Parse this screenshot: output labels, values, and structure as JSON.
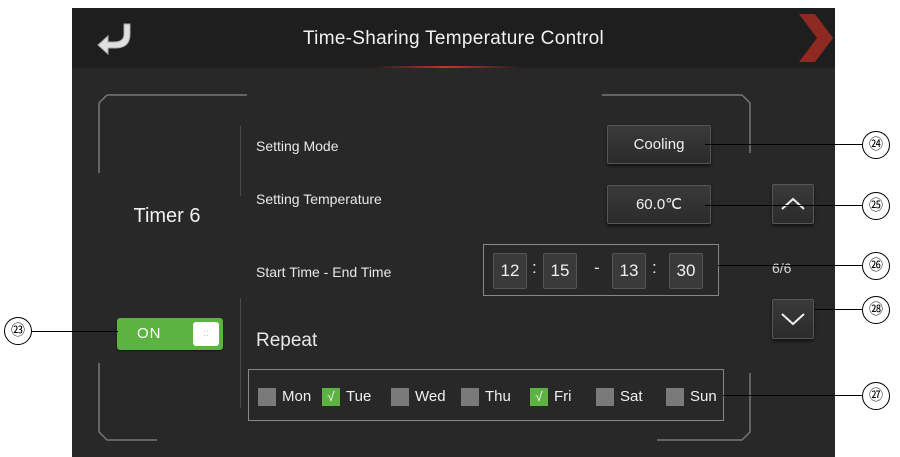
{
  "header": {
    "title": "Time-Sharing Temperature Control"
  },
  "timer": {
    "label": "Timer 6",
    "toggle_label": "ON",
    "toggle_state": true
  },
  "settings": {
    "mode_label": "Setting Mode",
    "mode_value": "Cooling",
    "temp_label": "Setting Temperature",
    "temp_value": "60.0℃",
    "time_label": "Start Time - End Time",
    "start_hour": "12",
    "start_minute": "15",
    "end_hour": "13",
    "end_minute": "30",
    "time_colon": ":",
    "range_dash": "-"
  },
  "pagination": {
    "indicator": "6/6"
  },
  "repeat": {
    "label": "Repeat",
    "days": [
      {
        "label": "Mon",
        "checked": false
      },
      {
        "label": "Tue",
        "checked": true
      },
      {
        "label": "Wed",
        "checked": false
      },
      {
        "label": "Thu",
        "checked": false
      },
      {
        "label": "Fri",
        "checked": true
      },
      {
        "label": "Sat",
        "checked": false
      },
      {
        "label": "Sun",
        "checked": false
      }
    ],
    "check_mark": "√"
  },
  "callouts": {
    "c23": "㉓",
    "c24": "㉔",
    "c25": "㉕",
    "c26": "㉖",
    "c27": "㉗",
    "c28": "㉘"
  },
  "colors": {
    "background": "#282828",
    "accent_green": "#5cb342",
    "accent_red": "#c0392b"
  },
  "icons": {
    "back": "back-arrow-icon",
    "next": "chevron-right-icon",
    "up": "chevron-up-icon",
    "down": "chevron-down-icon"
  }
}
